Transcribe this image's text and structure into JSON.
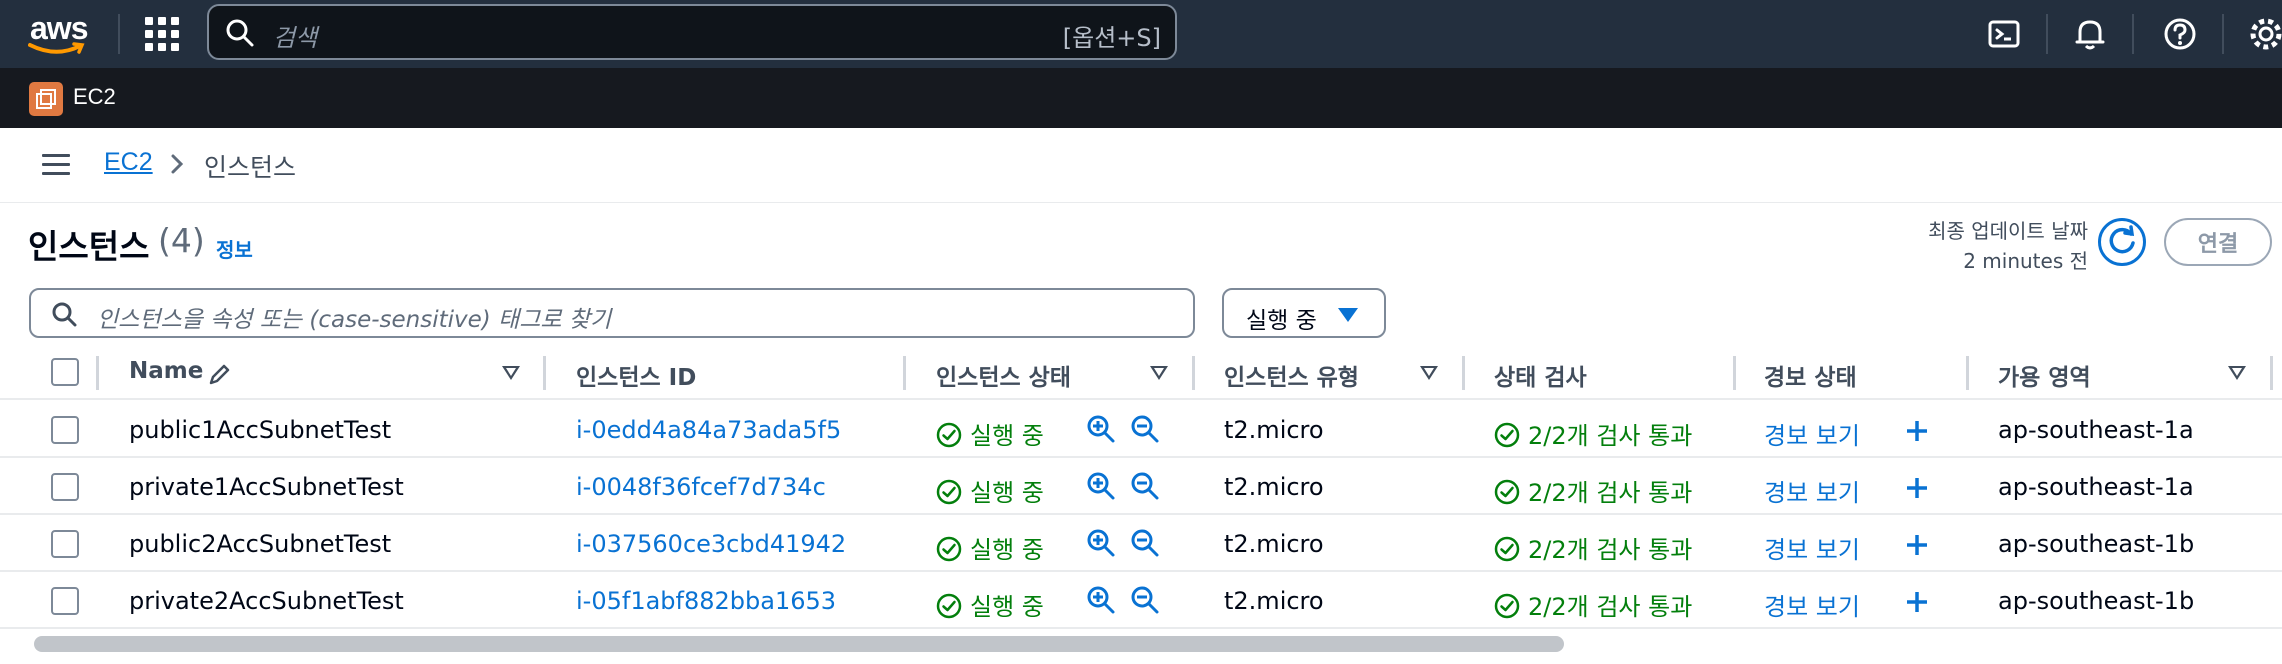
{
  "topnav": {
    "logo_text": "aws",
    "search_placeholder": "검색",
    "search_shortcut": "[옵션+S]",
    "icons": [
      "services-grid-icon",
      "cloudshell-icon",
      "bell-icon",
      "help-icon",
      "gear-icon"
    ]
  },
  "subnav": {
    "service_name": "EC2",
    "service_icon": "ec2-icon"
  },
  "breadcrumb": {
    "parent": "EC2",
    "current": "인스턴스"
  },
  "header": {
    "title": "인스턴스",
    "count": "(4)",
    "info": "정보",
    "last_updated_label": "최종 업데이트 날짜",
    "last_updated_value": "2 minutes 전",
    "connect_label": "연결"
  },
  "filter": {
    "placeholder": "인스턴스을 속성 또는 (case-sensitive) 태그로 찾기",
    "state_filter": "실행 중"
  },
  "table": {
    "columns": [
      "Name",
      "인스턴스 ID",
      "인스턴스 상태",
      "인스턴스 유형",
      "상태 검사",
      "경보 상태",
      "가용 영역"
    ],
    "rows": [
      {
        "name": "public1AccSubnetTest",
        "id": "i-0edd4a84a73ada5f5",
        "state": "실행 중",
        "type": "t2.micro",
        "check": "2/2개 검사 통과",
        "alarm": "경보 보기",
        "az": "ap-southeast-1a"
      },
      {
        "name": "private1AccSubnetTest",
        "id": "i-0048f36fcef7d734c",
        "state": "실행 중",
        "type": "t2.micro",
        "check": "2/2개 검사 통과",
        "alarm": "경보 보기",
        "az": "ap-southeast-1a"
      },
      {
        "name": "public2AccSubnetTest",
        "id": "i-037560ce3cbd41942",
        "state": "실행 중",
        "type": "t2.micro",
        "check": "2/2개 검사 통과",
        "alarm": "경보 보기",
        "az": "ap-southeast-1b"
      },
      {
        "name": "private2AccSubnetTest",
        "id": "i-05f1abf882bba1653",
        "state": "실행 중",
        "type": "t2.micro",
        "check": "2/2개 검사 통과",
        "alarm": "경보 보기",
        "az": "ap-southeast-1b"
      }
    ]
  },
  "colors": {
    "nav": "#232f3e",
    "subnav": "#16191f",
    "link": "#0972d3",
    "success": "#037f0c",
    "ec2_orange": "#e07941"
  }
}
